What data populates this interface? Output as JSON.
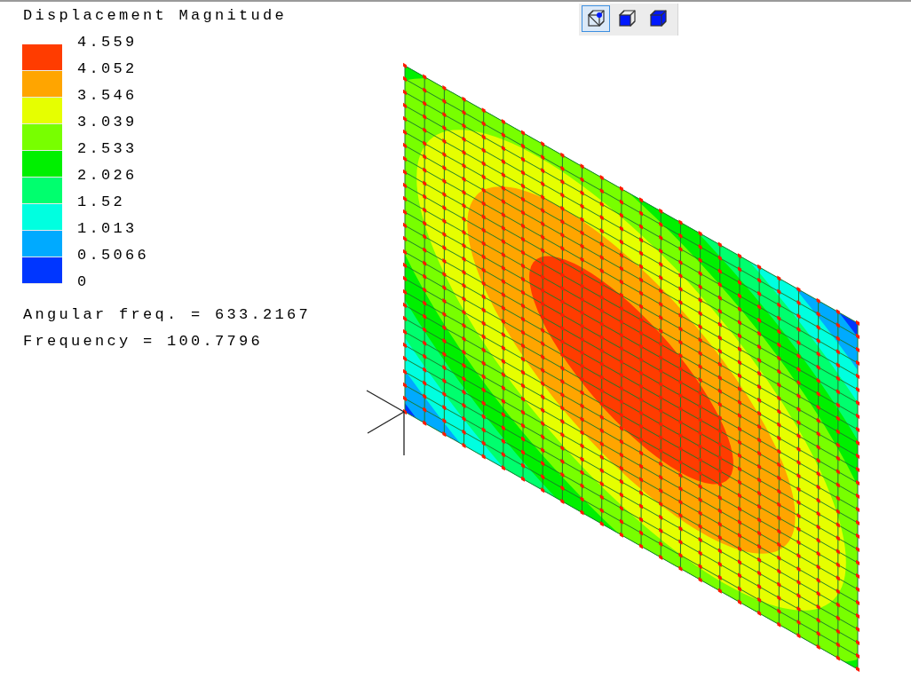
{
  "legend": {
    "title": "Displacement Magnitude",
    "bands": [
      {
        "color": "#ff3c00"
      },
      {
        "color": "#ffa500"
      },
      {
        "color": "#e6ff00"
      },
      {
        "color": "#78ff00"
      },
      {
        "color": "#00f000"
      },
      {
        "color": "#00ff6e"
      },
      {
        "color": "#00ffe0"
      },
      {
        "color": "#00aaff"
      },
      {
        "color": "#0036ff"
      }
    ],
    "labels": [
      "4.559",
      "4.052",
      "3.546",
      "3.039",
      "2.533",
      "2.026",
      "1.52",
      "1.013",
      "0.5066",
      "0"
    ]
  },
  "info": [
    "Angular freq. = 633.2167",
    "Frequency = 100.7796"
  ],
  "toolbar": [
    {
      "kind": "wireframe",
      "selected": true
    },
    {
      "kind": "face",
      "selected": false
    },
    {
      "kind": "solid",
      "selected": false
    }
  ]
}
